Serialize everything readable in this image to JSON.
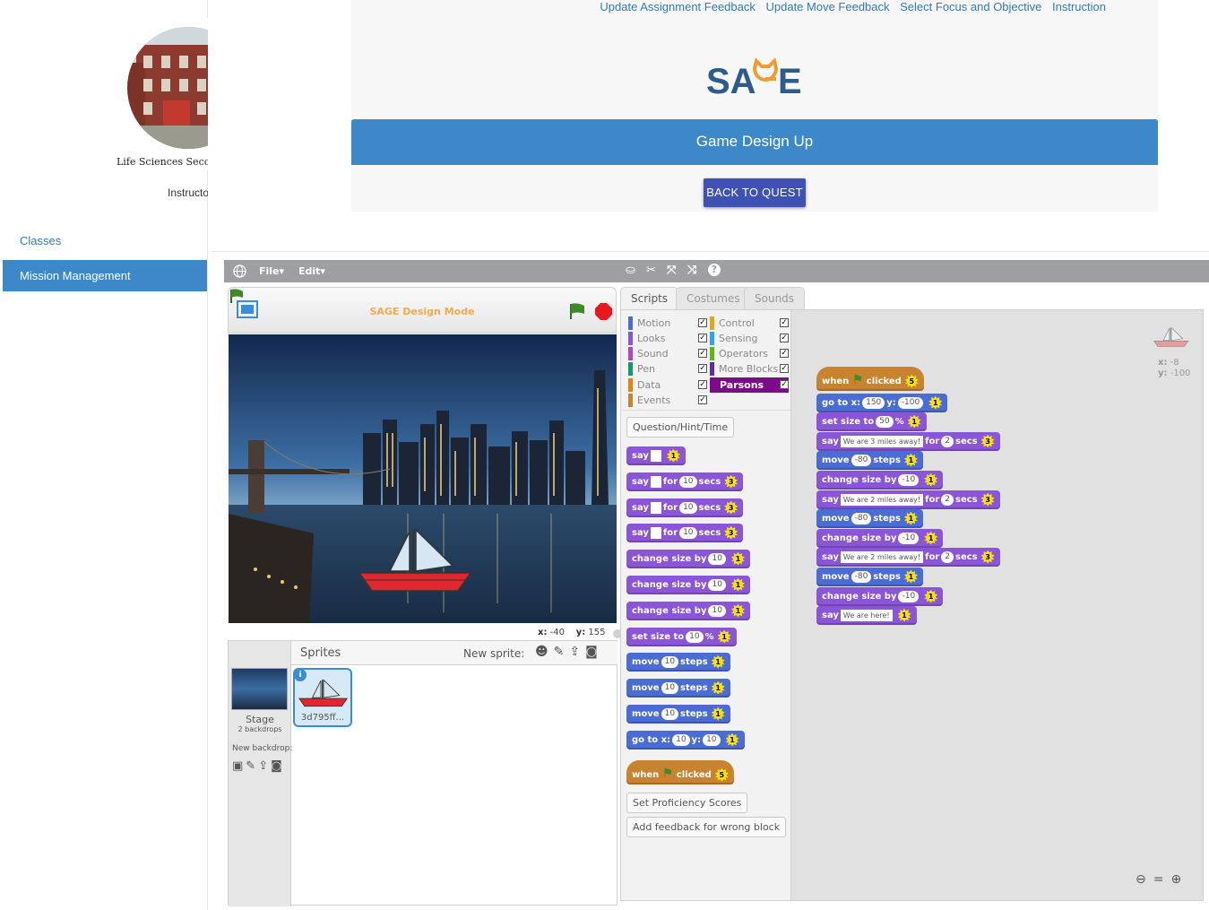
{
  "sidebar": {
    "school_name": "Life Sciences Secon",
    "instructor": "Instructor",
    "nav": [
      {
        "label": "Classes"
      },
      {
        "label": "Mission Management"
      }
    ]
  },
  "top_links": [
    "Update Assignment Feedback",
    "Update Move Feedback",
    "Select Focus and Objective",
    "Instruction"
  ],
  "logo": {
    "left": "SA",
    "right": "E"
  },
  "banner_title": "Game Design Up",
  "back_button": "BACK TO QUEST",
  "scratch": {
    "menus": [
      "File",
      "Edit"
    ],
    "stage_title": "SAGE Design Mode",
    "coords": {
      "x_label": "x:",
      "x": "-40",
      "y_label": "y:",
      "y": "155"
    },
    "sprites": {
      "header": "Sprites",
      "new_sprite": "New sprite:",
      "stage_label": "Stage",
      "stage_backdrops": "2 backdrops",
      "new_backdrop": "New backdrop:",
      "sprite_name": "3d795ff..."
    },
    "tabs": [
      "Scripts",
      "Costumes",
      "Sounds"
    ],
    "categories_left": [
      {
        "name": "Motion",
        "color": "#4a6cd4"
      },
      {
        "name": "Looks",
        "color": "#8a55d7"
      },
      {
        "name": "Sound",
        "color": "#bb42c3"
      },
      {
        "name": "Pen",
        "color": "#0e9a6c"
      },
      {
        "name": "Data",
        "color": "#ee7d16"
      },
      {
        "name": "Events",
        "color": "#c88330"
      }
    ],
    "categories_right": [
      {
        "name": "Control",
        "color": "#e1a91a"
      },
      {
        "name": "Sensing",
        "color": "#2ca5e2"
      },
      {
        "name": "Operators",
        "color": "#5cb712"
      },
      {
        "name": "More Blocks",
        "color": "#632d99"
      },
      {
        "name": "Parsons",
        "color": "#7c0a8a"
      }
    ],
    "palette_buttons": {
      "question": "Question/Hint/Time",
      "proficiency": "Set Proficiency Scores",
      "feedback": "Add feedback for wrong block"
    },
    "palette_blocks": {
      "say": "say",
      "for": "for",
      "secs": "secs",
      "change_size": "change size by",
      "set_size": "set size to",
      "pct": "%",
      "move": "move",
      "steps": "steps",
      "goto": "go to x:",
      "y": "y:",
      "when": "when",
      "clicked": "clicked",
      "ten": "10",
      "one": "1",
      "three": "3",
      "five": "5"
    },
    "script": {
      "when": "when",
      "clicked": "clicked",
      "goto": "go to x:",
      "goto_x": "150",
      "goto_y_label": "y:",
      "goto_y": "-100",
      "set_size": "set size to",
      "set_size_val": "50",
      "pct": "%",
      "say": "say",
      "msg1": "We are 3 miles away!",
      "msg2": "We are 2 miles away!",
      "msg3": "We are 2 miles away!",
      "msg4": "We are here!",
      "for": "for",
      "secs": "secs",
      "two": "2",
      "move": "move",
      "steps": "steps",
      "move_val": "-80",
      "change_size": "change size by",
      "change_val": "-10",
      "one": "1",
      "three": "3",
      "five": "5"
    },
    "sprite_pos": {
      "x_label": "x:",
      "x": "-8",
      "y_label": "y:",
      "y": "-100"
    }
  }
}
